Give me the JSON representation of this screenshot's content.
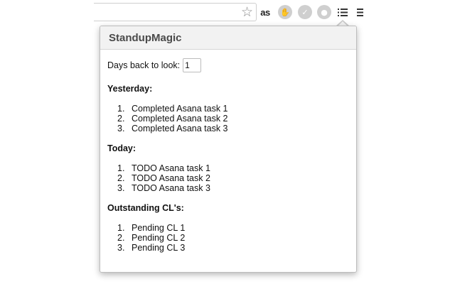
{
  "toolbar": {
    "lastfm_icon_text": "as"
  },
  "popup": {
    "title": "StandupMagic",
    "days_label": "Days back to look:",
    "days_value": "1",
    "sections": [
      {
        "heading": "Yesterday:",
        "items": [
          "Completed Asana task 1",
          "Completed Asana task 2",
          "Completed Asana task 3"
        ]
      },
      {
        "heading": "Today:",
        "items": [
          "TODO Asana task 1",
          "TODO Asana task 2",
          "TODO Asana task 3"
        ]
      },
      {
        "heading": "Outstanding CL's:",
        "items": [
          "Pending CL 1",
          "Pending CL 2",
          "Pending CL 3"
        ]
      }
    ]
  }
}
